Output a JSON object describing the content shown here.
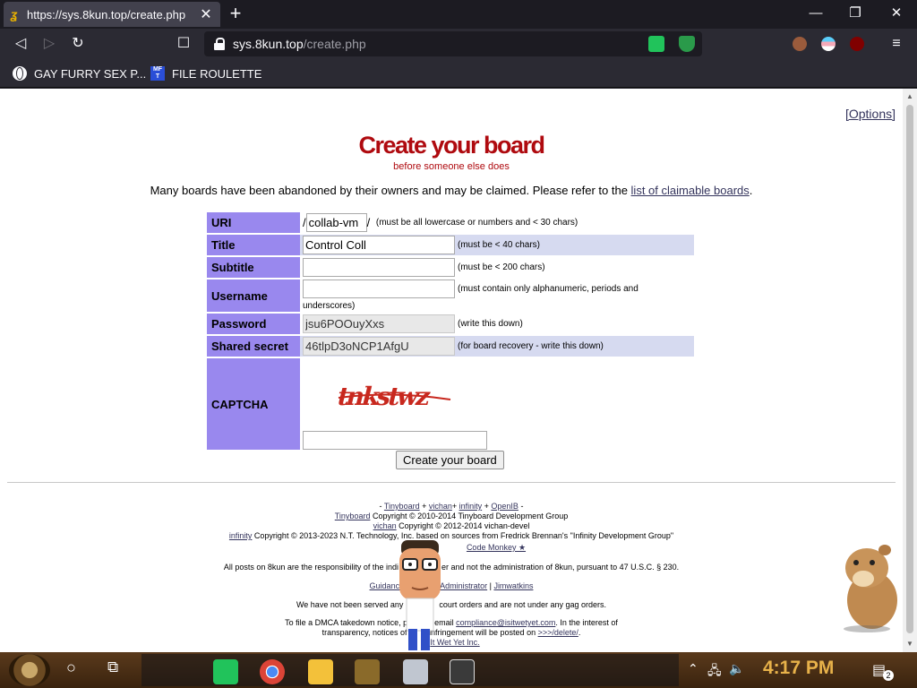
{
  "browser": {
    "tab_title": "https://sys.8kun.top/create.php",
    "tab_favicon": "ʓ",
    "url_host": "sys.8kun.top",
    "url_path": "/create.php",
    "bookmarks": [
      {
        "label": "GAY FURRY SEX P..."
      },
      {
        "label": "FILE ROULETTE",
        "icon_text": "MF T"
      }
    ]
  },
  "page": {
    "options_label": "[Options]",
    "title": "Create your board",
    "subtitle": "before someone else does",
    "intro_text": "Many boards have been abandoned by their owners and may be claimed. Please refer to the ",
    "intro_link": "list of claimable boards",
    "intro_end": ".",
    "form": {
      "uri": {
        "label": "URI",
        "value": "collab-vm",
        "prefix": "/",
        "suffix": "/",
        "hint": "(must be all lowercase or numbers and < 30 chars)"
      },
      "title": {
        "label": "Title",
        "value": "Control Coll",
        "hint": "(must be < 40 chars)"
      },
      "subtitle": {
        "label": "Subtitle",
        "value": "",
        "hint": "(must be < 200 chars)"
      },
      "username": {
        "label": "Username",
        "value": "",
        "hint": "(must contain only alphanumeric, periods and underscores)"
      },
      "password": {
        "label": "Password",
        "value": "jsu6POOuyXxs",
        "hint": "(write this down)"
      },
      "secret": {
        "label": "Shared secret",
        "value": "46tlpD3oNCP1AfgU",
        "hint": "(for board recovery - write this down)"
      },
      "captcha": {
        "label": "CAPTCHA",
        "image_text": "tnkstwz",
        "value": ""
      },
      "submit_label": "Create your board"
    },
    "footer": {
      "l1_pre": "- ",
      "l1_a": "Tinyboard",
      "l1_m1": " + ",
      "l1_b": "vichan",
      "l1_m2": "+ ",
      "l1_c": "infinity",
      "l1_m3": " + ",
      "l1_d": "OpenIB",
      "l1_post": " -",
      "l2_a": "Tinyboard",
      "l2_text": " Copyright © 2010-2014 Tinyboard Development Group",
      "l3_a": "vichan",
      "l3_text": " Copyright © 2012-2014 vichan-devel",
      "l4_a": "infinity",
      "l4_text": " Copyright © 2013-2023 N.T. Technology, Inc. based on sources from Fredrick Brennan's \"Infinity Development Group\"",
      "l5_a": "Code Monkey ★",
      "l6_pre": "All posts on 8kun are the responsibility of the indi",
      "l6_post": "er and not the administration of 8kun, pursuant to 47 U.S.C. § 230.",
      "l7_a": "Guidance",
      "l7_b": "Administrator",
      "l7_sep": " | ",
      "l7_c": "Jimwatkins",
      "l8_pre": "We have not been served any",
      "l8_post": "court orders and are not under any gag orders.",
      "l9_pre": "To file a DMCA takedown notice, p",
      "l9_mid": "email ",
      "l9_a": "compliance@isitwetyet.com",
      "l9_post": ". In the interest of",
      "l10_pre": "transparency, notices of c",
      "l10_mid": "d infringement will be posted on ",
      "l10_a": ">>>/delete/",
      "l10_post": ".",
      "l11_a": "It Wet Yet Inc."
    }
  },
  "taskbar": {
    "clock": "4:17 PM",
    "notification_count": "2"
  },
  "colors": {
    "title_red": "#af0a0f",
    "label_bg": "#9988ee",
    "alt_row": "#d6daf0",
    "link": "#34345c",
    "clock": "#e8b24a"
  }
}
